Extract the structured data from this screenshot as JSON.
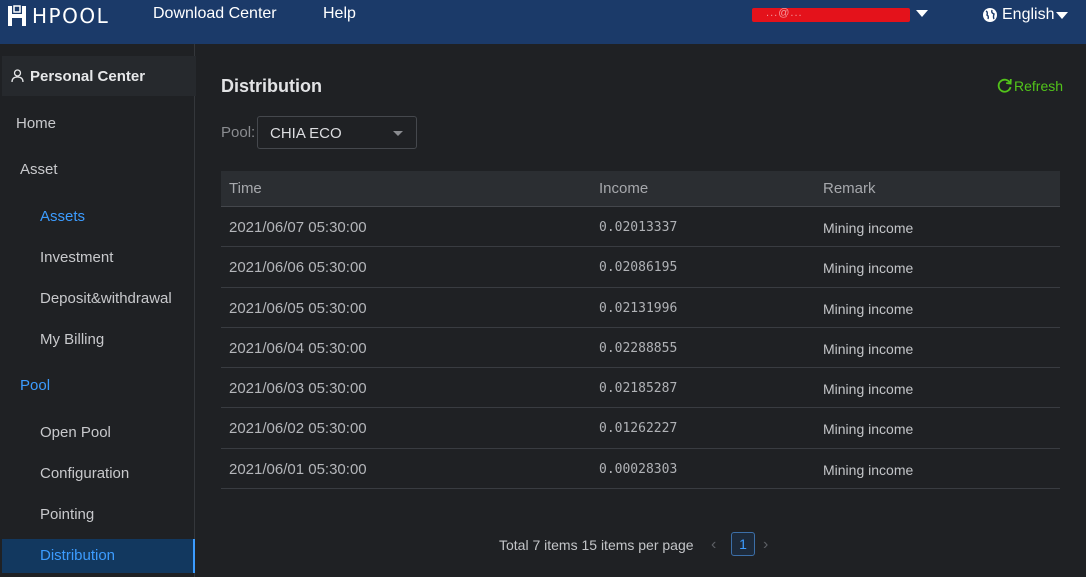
{
  "header": {
    "logo_text": "HPOOL",
    "nav": [
      "Download Center",
      "Help"
    ],
    "account_label": "​ ...@... ​",
    "language": "English",
    "brand_color": "#1b3a69"
  },
  "sidebar": {
    "section_title": "Personal Center",
    "items": [
      {
        "label": "Home"
      },
      {
        "label": "Asset"
      },
      {
        "label": "Assets"
      },
      {
        "label": "Investment"
      },
      {
        "label": "Deposit&withdrawal"
      },
      {
        "label": "My Billing"
      },
      {
        "label": "Pool"
      },
      {
        "label": "Open Pool"
      },
      {
        "label": "Configuration"
      },
      {
        "label": "Pointing"
      },
      {
        "label": "Distribution"
      }
    ],
    "active_color": "#3c9cff"
  },
  "main": {
    "title": "Distribution",
    "refresh_label": "Refresh",
    "pool_label": "Pool:",
    "pool_value": "CHIA ECO",
    "columns": [
      "Time",
      "Income",
      "Remark"
    ],
    "rows": [
      {
        "time": "2021/06/07 05:30:00",
        "income": "0.02013337",
        "remark": "Mining income"
      },
      {
        "time": "2021/06/06 05:30:00",
        "income": "0.02086195",
        "remark": "Mining income"
      },
      {
        "time": "2021/06/05 05:30:00",
        "income": "0.02131996",
        "remark": "Mining income"
      },
      {
        "time": "2021/06/04 05:30:00",
        "income": "0.02288855",
        "remark": "Mining income"
      },
      {
        "time": "2021/06/03 05:30:00",
        "income": "0.02185287",
        "remark": "Mining income"
      },
      {
        "time": "2021/06/02 05:30:00",
        "income": "0.01262227",
        "remark": "Mining income"
      },
      {
        "time": "2021/06/01 05:30:00",
        "income": "0.00028303",
        "remark": "Mining income"
      }
    ],
    "pagination": {
      "summary": "Total 7 items 15 items per page",
      "prev": "‹",
      "next": "›",
      "current_page": "1"
    }
  }
}
